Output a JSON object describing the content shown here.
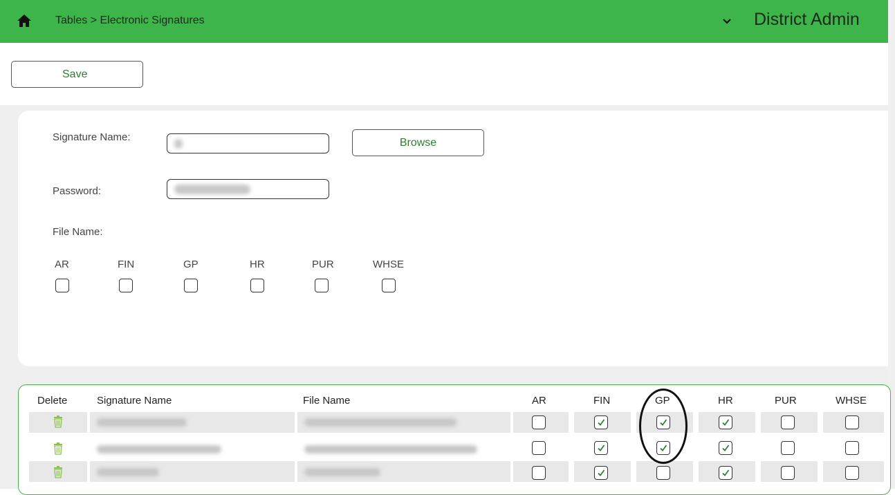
{
  "header": {
    "breadcrumb": "Tables > Electronic Signatures",
    "district": "District Admin",
    "home_icon": "home-icon",
    "menu_icon": "chevron-down-icon"
  },
  "toolbar": {
    "save_label": "Save"
  },
  "form": {
    "signature_name_label": "Signature Name:",
    "password_label": "Password:",
    "file_name_label": "File Name:",
    "browse_label": "Browse",
    "modules": [
      "AR",
      "FIN",
      "GP",
      "HR",
      "PUR",
      "WHSE"
    ]
  },
  "grid": {
    "columns": [
      "Delete",
      "Signature Name",
      "File Name",
      "AR",
      "FIN",
      "GP",
      "HR",
      "PUR",
      "WHSE"
    ],
    "rows": [
      {
        "AR": false,
        "FIN": true,
        "GP": true,
        "HR": true,
        "PUR": false,
        "WHSE": false
      },
      {
        "AR": false,
        "FIN": true,
        "GP": true,
        "HR": true,
        "PUR": false,
        "WHSE": false
      },
      {
        "AR": false,
        "FIN": true,
        "GP": false,
        "HR": true,
        "PUR": false,
        "WHSE": false
      }
    ]
  },
  "colors": {
    "header_green": "#3db54a",
    "accent_text": "#2e7d32",
    "grid_border": "#4caf50"
  }
}
